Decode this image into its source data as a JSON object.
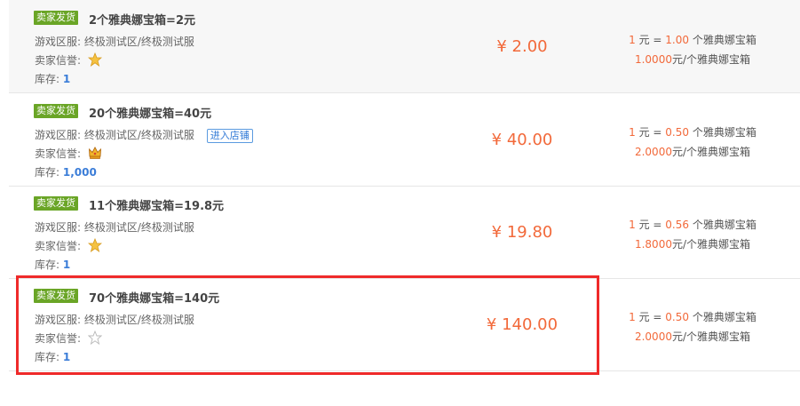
{
  "listings": [
    {
      "badge": "卖家发货",
      "title": "2个雅典娜宝箱=2元",
      "server_label": "游戏区服:",
      "server": "终极测试区/终极测试服",
      "reputation_label": "卖家信誉:",
      "reputation_icon": "gold-star-icon",
      "stock_label": "库存:",
      "stock": "1",
      "price": "¥ 2.00",
      "rate1_num": "1",
      "rate1_mid": "元 =",
      "rate1_val": "1.00",
      "rate1_unit": "个雅典娜宝箱",
      "rate2_val": "1.0000",
      "rate2_unit": "元/个雅典娜宝箱"
    },
    {
      "badge": "卖家发货",
      "title": "20个雅典娜宝箱=40元",
      "server_label": "游戏区服:",
      "server": "终极测试区/终极测试服",
      "shop_button": "进入店铺",
      "reputation_label": "卖家信誉:",
      "reputation_icon": "crown-icon",
      "stock_label": "库存:",
      "stock": "1,000",
      "price": "¥ 40.00",
      "rate1_num": "1",
      "rate1_mid": "元 =",
      "rate1_val": "0.50",
      "rate1_unit": "个雅典娜宝箱",
      "rate2_val": "2.0000",
      "rate2_unit": "元/个雅典娜宝箱"
    },
    {
      "badge": "卖家发货",
      "title": "11个雅典娜宝箱=19.8元",
      "server_label": "游戏区服:",
      "server": "终极测试区/终极测试服",
      "reputation_label": "卖家信誉:",
      "reputation_icon": "gold-star-icon",
      "stock_label": "库存:",
      "stock": "1",
      "price": "¥ 19.80",
      "rate1_num": "1",
      "rate1_mid": "元 =",
      "rate1_val": "0.56",
      "rate1_unit": "个雅典娜宝箱",
      "rate2_val": "1.8000",
      "rate2_unit": "元/个雅典娜宝箱"
    },
    {
      "badge": "卖家发货",
      "title": "70个雅典娜宝箱=140元",
      "server_label": "游戏区服:",
      "server": "终极测试区/终极测试服",
      "reputation_label": "卖家信誉:",
      "reputation_icon": "empty-star-icon",
      "stock_label": "库存:",
      "stock": "1",
      "price": "¥ 140.00",
      "rate1_num": "1",
      "rate1_mid": "元 =",
      "rate1_val": "0.50",
      "rate1_unit": "个雅典娜宝箱",
      "rate2_val": "2.0000",
      "rate2_unit": "元/个雅典娜宝箱"
    }
  ],
  "colors": {
    "badge_bg": "#6aa526",
    "price": "#f2693a",
    "stock": "#3b7dd8",
    "highlight": "#ef2a2a"
  }
}
